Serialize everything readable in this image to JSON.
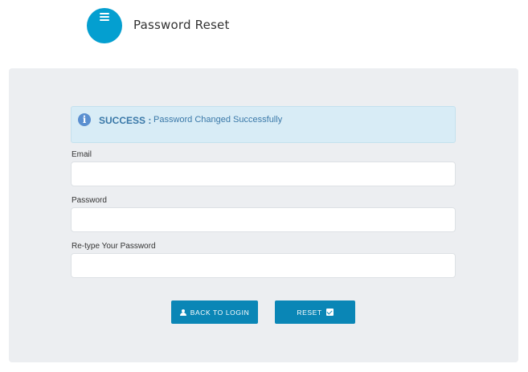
{
  "header": {
    "title": "Password Reset",
    "logo_color": "#049fd0",
    "menu_icon": "menu-icon"
  },
  "alert": {
    "label": "SUCCESS :",
    "message": "Password Changed Successfully",
    "icon": "info-icon",
    "icon_glyph": "i"
  },
  "form": {
    "email_label": "Email",
    "email_value": "",
    "password_label": "Password",
    "password_value": "",
    "retype_label": "Re-type Your Password",
    "retype_value": ""
  },
  "buttons": {
    "back_label": "BACK TO LOGIN",
    "back_icon": "user-icon",
    "reset_label": "RESET",
    "reset_icon": "check-square-icon",
    "accent": "#0a86b6"
  }
}
